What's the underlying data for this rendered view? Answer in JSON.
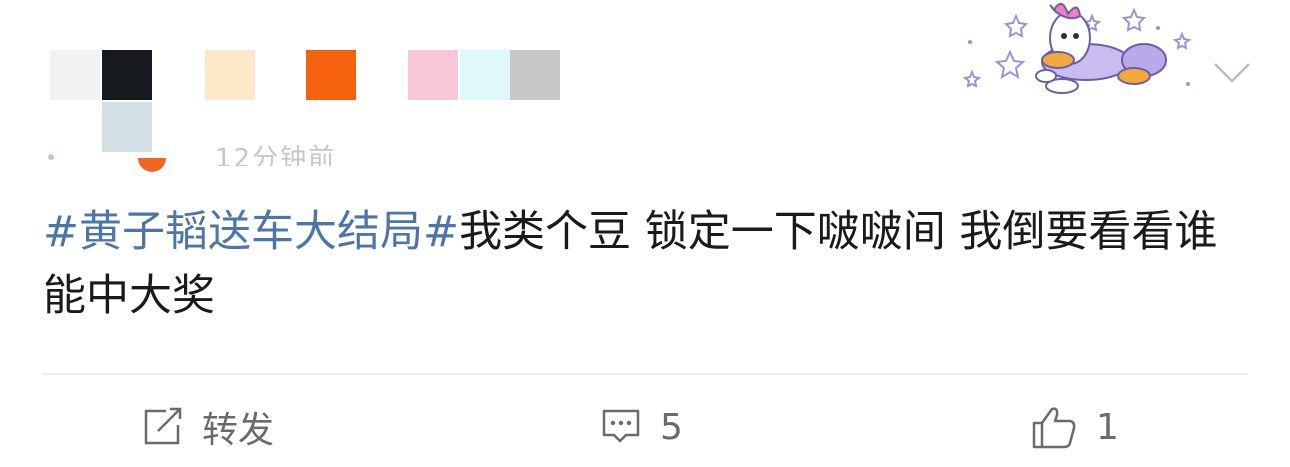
{
  "header": {
    "mosaic_colors": [
      "#f0f2f4",
      "#16191d",
      "#fde9c9",
      "#f5620d",
      "#f7c6d8",
      "#def8fb",
      "#c8c8c8",
      "#d2e0e5"
    ],
    "time_text": "12分钟前",
    "chevron_icon": "chevron-down-icon",
    "decoration_icon": "daisy-duck-sticker"
  },
  "post": {
    "hashtag": "#黄子韬送车大结局#",
    "body": "我类个豆 锁定一下啵啵间 我倒要看看谁能中大奖"
  },
  "actions": {
    "repost_label": "转发",
    "comment_count": "5",
    "like_count": "1"
  },
  "colors": {
    "hashtag": "#4d76a6",
    "text": "#1a1a1a",
    "muted": "#6b6b6b"
  }
}
